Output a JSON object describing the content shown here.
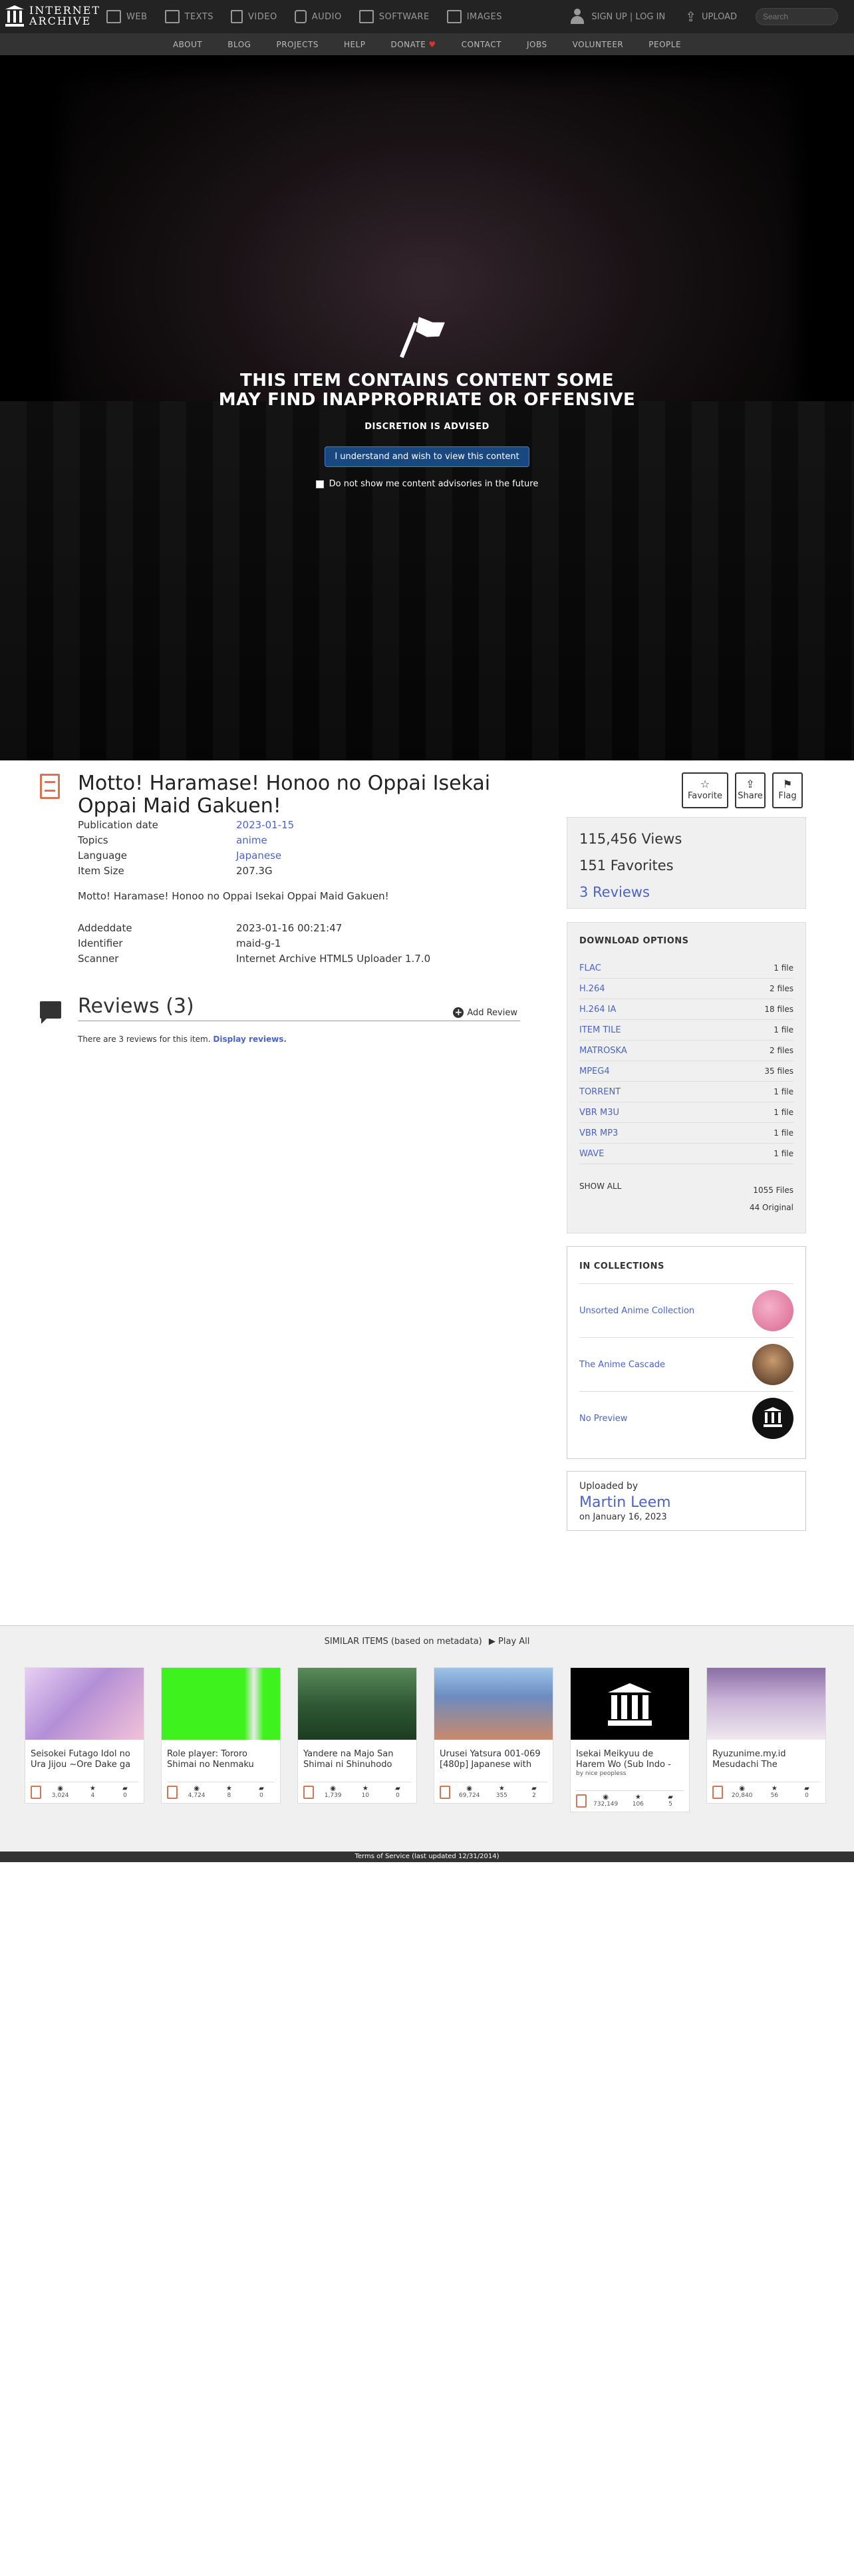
{
  "topbar": {
    "logo_line1": "INTERNET",
    "logo_line2": "ARCHIVE",
    "nav": [
      {
        "label": "WEB",
        "icon": "web-icon"
      },
      {
        "label": "TEXTS",
        "icon": "book-icon"
      },
      {
        "label": "VIDEO",
        "icon": "film-icon"
      },
      {
        "label": "AUDIO",
        "icon": "speaker-icon"
      },
      {
        "label": "SOFTWARE",
        "icon": "floppy-icon"
      },
      {
        "label": "IMAGES",
        "icon": "image-icon"
      }
    ],
    "signup": "SIGN UP | LOG IN",
    "upload": "UPLOAD",
    "search_placeholder": "Search"
  },
  "subnav": [
    "ABOUT",
    "BLOG",
    "PROJECTS",
    "HELP",
    "DONATE",
    "CONTACT",
    "JOBS",
    "VOLUNTEER",
    "PEOPLE"
  ],
  "advisory": {
    "title_line1": "THIS ITEM CONTAINS CONTENT SOME",
    "title_line2": "MAY FIND INAPPROPRIATE OR OFFENSIVE",
    "subtitle": "DISCRETION IS ADVISED",
    "button": "I understand and wish to view this content",
    "checkbox": "Do not show me content advisories in the future"
  },
  "item": {
    "title": "Motto! Haramase! Honoo no Oppai Isekai Oppai Maid Gakuen!",
    "metadata": [
      {
        "key": "Publication date",
        "value": "2023-01-15",
        "link": true
      },
      {
        "key": "Topics",
        "value": "anime",
        "link": true
      },
      {
        "key": "Language",
        "value": "Japanese",
        "link": true
      },
      {
        "key": "Item Size",
        "value": "207.3G",
        "link": false
      }
    ],
    "description": "Motto! Haramase! Honoo no Oppai Isekai Oppai Maid Gakuen!",
    "metadata2": [
      {
        "key": "Addeddate",
        "value": "2023-01-16 00:21:47"
      },
      {
        "key": "Identifier",
        "value": "maid-g-1"
      },
      {
        "key": "Scanner",
        "value": "Internet Archive HTML5 Uploader 1.7.0"
      }
    ],
    "reviews_title": "Reviews (3)",
    "add_review": "Add Review",
    "reviews_note": "There are 3 reviews for this item.",
    "reviews_link": "Display reviews."
  },
  "actions": {
    "favorite": "Favorite",
    "share": "Share",
    "flag": "Flag"
  },
  "stats": {
    "views": "115,456 Views",
    "favorites": "151 Favorites",
    "reviews": "3 Reviews"
  },
  "downloads": {
    "heading": "DOWNLOAD OPTIONS",
    "rows": [
      {
        "format": "FLAC",
        "count": "1 file"
      },
      {
        "format": "H.264",
        "count": "2 files"
      },
      {
        "format": "H.264 IA",
        "count": "18 files"
      },
      {
        "format": "ITEM TILE",
        "count": "1 file"
      },
      {
        "format": "MATROSKA",
        "count": "2 files"
      },
      {
        "format": "MPEG4",
        "count": "35 files"
      },
      {
        "format": "TORRENT",
        "count": "1 file"
      },
      {
        "format": "VBR M3U",
        "count": "1 file"
      },
      {
        "format": "VBR MP3",
        "count": "1 file"
      },
      {
        "format": "WAVE",
        "count": "1 file"
      }
    ],
    "show_all": "SHOW ALL",
    "total_files": "1055 Files",
    "original": "44 Original"
  },
  "collections": {
    "heading": "IN COLLECTIONS",
    "items": [
      {
        "name": "Unsorted Anime Collection",
        "color": "#e88aa8"
      },
      {
        "name": "The Anime Cascade",
        "color": "#6b4a38"
      },
      {
        "name": "No Preview",
        "color": "#111111"
      }
    ]
  },
  "uploader": {
    "label": "Uploaded by",
    "name": "Martin Leem",
    "date": "on January 16, 2023"
  },
  "similar": {
    "heading": "SIMILAR ITEMS (based on metadata)",
    "play_all": "Play All",
    "cards": [
      {
        "title": "Seisokei Futago Idol no Ura Jijou ~Ore Dake ga",
        "by": "",
        "views": "3,024",
        "favs": "4",
        "reviews": "0",
        "thumb_color": "#b48fd6"
      },
      {
        "title": "Role player: Tororo Shimai no Nenmaku",
        "by": "",
        "views": "4,724",
        "favs": "8",
        "reviews": "0",
        "thumb_color": "#3ef21e"
      },
      {
        "title": "Yandere na Majo San Shimai ni Shinuhodo",
        "by": "",
        "views": "1,739",
        "favs": "10",
        "reviews": "0",
        "thumb_color": "#2f5a34"
      },
      {
        "title": "Urusei Yatsura 001-069 [480p] Japanese with",
        "by": "",
        "views": "69,724",
        "favs": "355",
        "reviews": "2",
        "thumb_color": "#6c8cc0"
      },
      {
        "title": "Isekai Meikyuu de Harem Wo (Sub Indo -",
        "by": "by nice peopless",
        "views": "732,149",
        "favs": "106",
        "reviews": "5",
        "thumb_color": "#000000"
      },
      {
        "title": "Ryuzunime.my.id Mesudachi The",
        "by": "",
        "views": "20,840",
        "favs": "56",
        "reviews": "0",
        "thumb_color": "#c9b3d6"
      }
    ]
  },
  "footer": "Terms of Service (last updated 12/31/2014)"
}
